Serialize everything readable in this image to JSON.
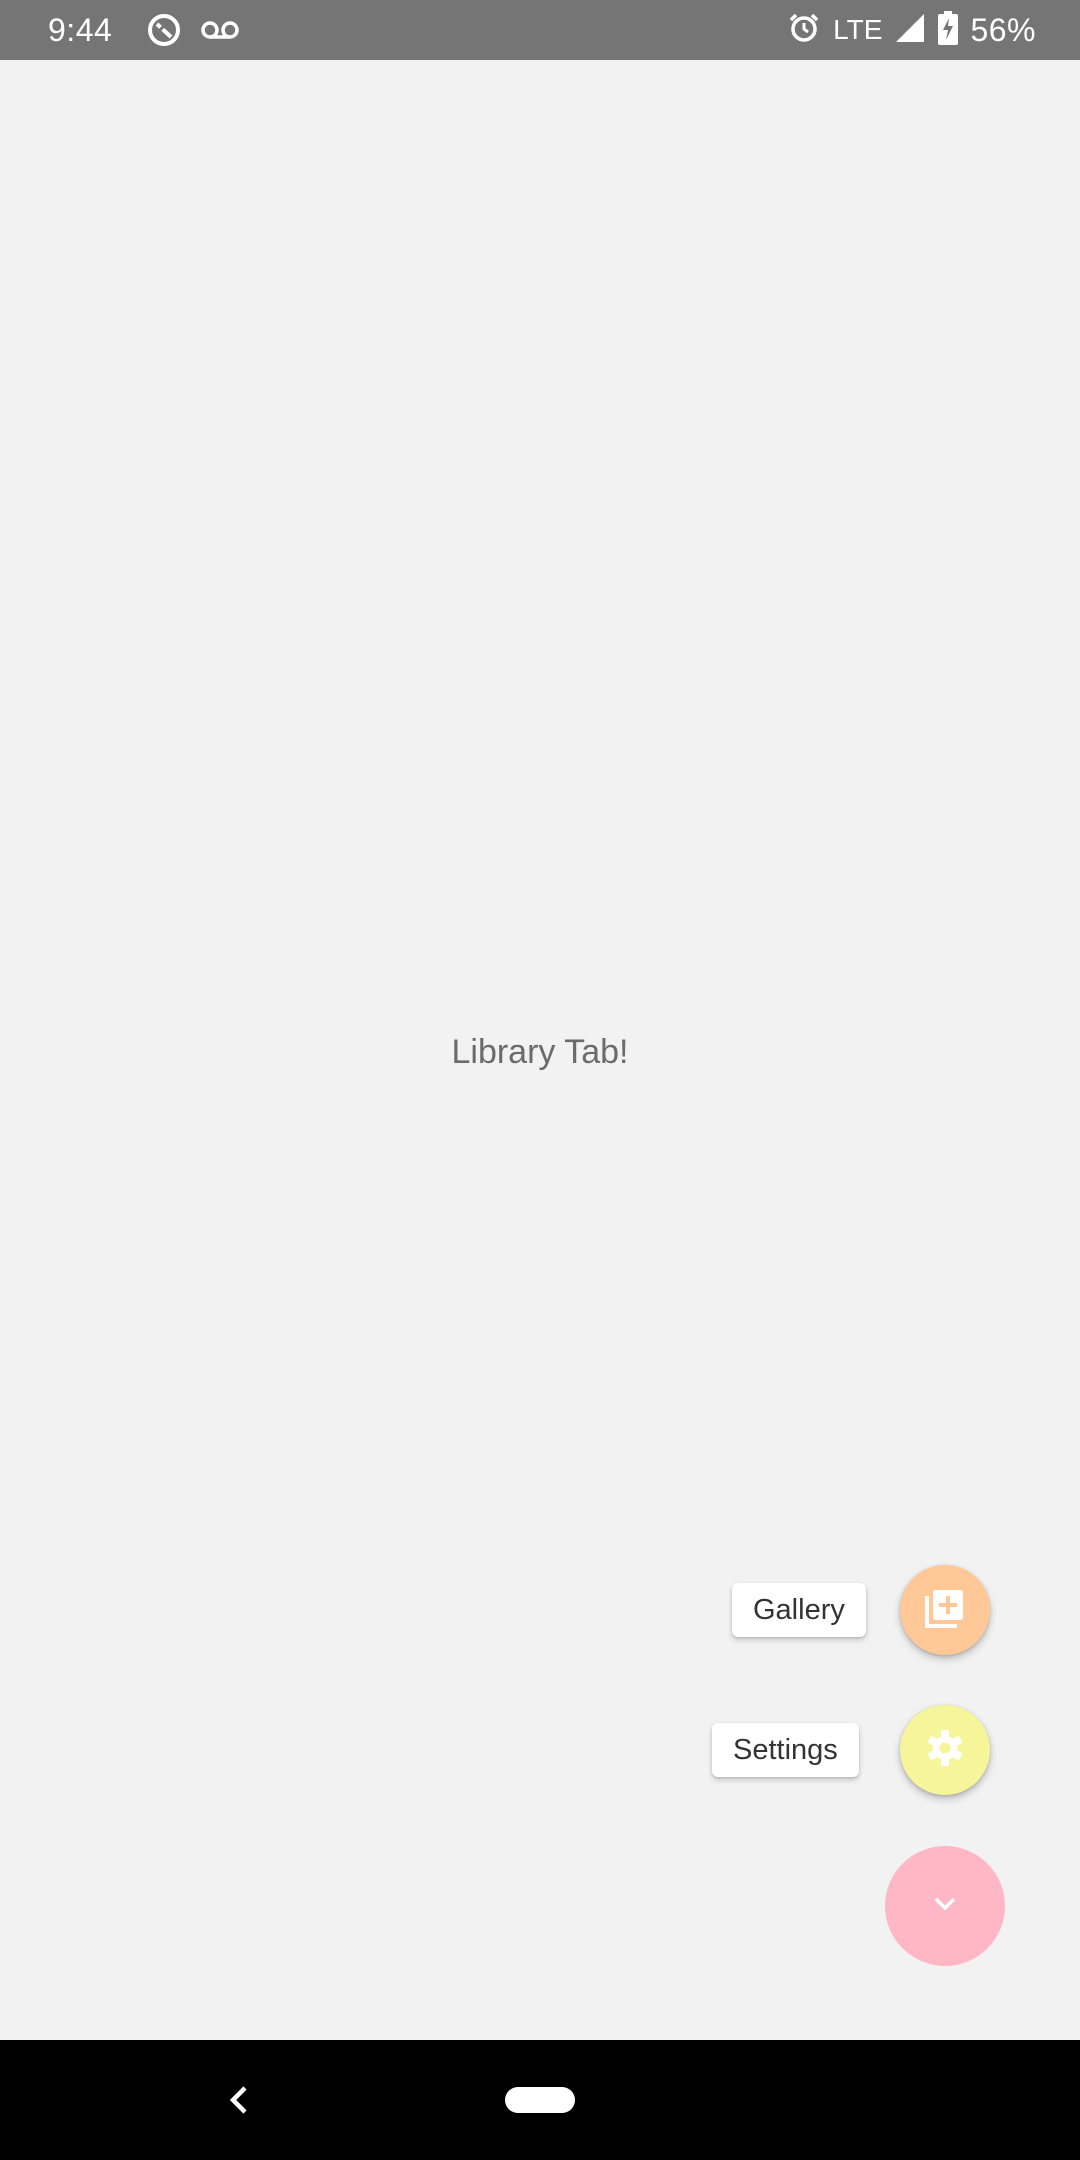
{
  "status_bar": {
    "time": "9:44",
    "network": "LTE",
    "battery": "56%",
    "icons": [
      "data-saver-icon",
      "voicemail-icon",
      "alarm-icon",
      "signal-icon",
      "battery-charging-icon"
    ]
  },
  "main": {
    "center_text": "Library Tab!"
  },
  "fab_menu": {
    "items": [
      {
        "label": "Gallery",
        "icon": "add-to-library-icon",
        "color": "#ffc896"
      },
      {
        "label": "Settings",
        "icon": "gear-icon",
        "color": "#f7f59a"
      }
    ],
    "main_button": {
      "icon": "chevron-down-icon",
      "color": "#ffb7c5"
    }
  },
  "nav_bar": {
    "icons": [
      "back-icon",
      "home-pill-icon"
    ]
  }
}
